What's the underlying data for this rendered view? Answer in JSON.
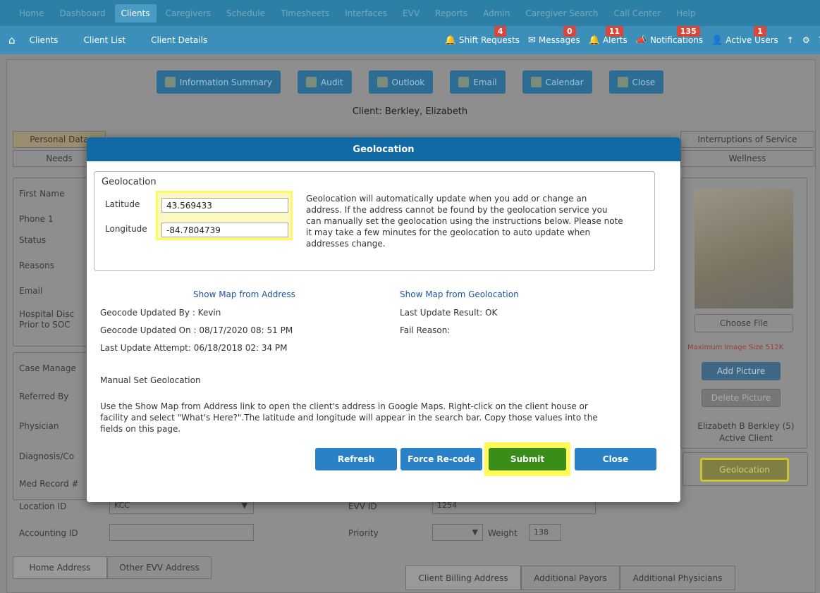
{
  "topnav": [
    "Home",
    "Dashboard",
    "Clients",
    "Caregivers",
    "Schedule",
    "Timesheets",
    "Interfaces",
    "EVV",
    "Reports",
    "Admin",
    "Caregiver Search",
    "Call Center",
    "Help"
  ],
  "subnav": {
    "items": [
      "Clients",
      "Client List",
      "Client Details"
    ]
  },
  "status": {
    "shift_requests": {
      "label": "Shift Requests",
      "count": "4"
    },
    "messages": {
      "label": "Messages",
      "count": "0"
    },
    "alerts": {
      "label": "Alerts",
      "count": "11"
    },
    "notifications": {
      "label": "Notifications",
      "count": "135"
    },
    "active_users": {
      "label": "Active Users",
      "count": "1"
    }
  },
  "page_buttons": [
    "Information Summary",
    "Audit",
    "Outlook",
    "Email",
    "Calendar",
    "Close"
  ],
  "client_title": "Client: Berkley, Elizabeth",
  "tabs": {
    "personal_data": "Personal Data",
    "needs": "Needs",
    "interruptions": "Interruptions of Service",
    "wellness": "Wellness"
  },
  "form_labels": [
    "First Name",
    "Phone 1",
    "Status",
    "Reasons",
    "Email",
    "Hospital Disc",
    "Prior to SOC",
    "Case Manage",
    "Referred By",
    "Physician",
    "Diagnosis/Co",
    "Med Record #",
    "Location ID",
    "Accounting ID"
  ],
  "form": {
    "location_id_value": "KCC",
    "evv_id_label": "EVV ID",
    "evv_id_value": "1254",
    "priority_label": "Priority",
    "weight_label": "Weight",
    "weight_value": "138"
  },
  "right_panel": {
    "choose_file": "Choose File",
    "max_size": "Maximum Image Size 512K",
    "add_picture": "Add Picture",
    "delete_picture": "Delete Picture",
    "client_name": "Elizabeth B Berkley (5)",
    "client_status": "Active Client",
    "geolocation_btn": "Geolocation"
  },
  "bottom_tabs": {
    "home_address": "Home Address",
    "other_evv": "Other EVV Address",
    "billing": "Client Billing Address",
    "payors": "Additional Payors",
    "physicians": "Additional Physicians"
  },
  "modal": {
    "title": "Geolocation",
    "group_label": "Geolocation",
    "latitude_label": "Latitude",
    "latitude_value": "43.569433",
    "longitude_label": "Longitude",
    "longitude_value": "-84.7804739",
    "info_lines": [
      "Geolocation will automatically update when you add or change an",
      "address. If the address cannot be found by the geolocation service you",
      "can manually set the geolocation using the instructions below. Please note",
      "it may take a few minutes for the geolocation to auto update when",
      "addresses change."
    ],
    "show_map_address": "Show Map from Address",
    "show_map_geo": "Show Map from Geolocation",
    "updated_by": "Geocode Updated By : Kevin",
    "updated_on": "Geocode Updated On : 08/17/2020 08: 51 PM",
    "last_attempt": "Last Update Attempt: 06/18/2018 02: 34 PM",
    "last_result": "Last Update Result: OK",
    "fail_reason": "Fail Reason:",
    "manual_title": "Manual Set Geolocation",
    "manual_lines": [
      "Use the Show Map from Address link to open the client's address in Google Maps. Right-click on the client house or",
      "facility and select \"What's Here?\".The latitude and longitude will appear in the search bar. Copy those values into the",
      "fields on this page."
    ],
    "buttons": {
      "refresh": "Refresh",
      "force_recode": "Force Re-code",
      "submit": "Submit",
      "close": "Close"
    }
  },
  "colors": {
    "nav": "#2e7fa5",
    "modal_header": "#116aa3",
    "highlight": "#fffa58",
    "submit": "#3b8d1a",
    "button_blue": "#2b81c5"
  }
}
